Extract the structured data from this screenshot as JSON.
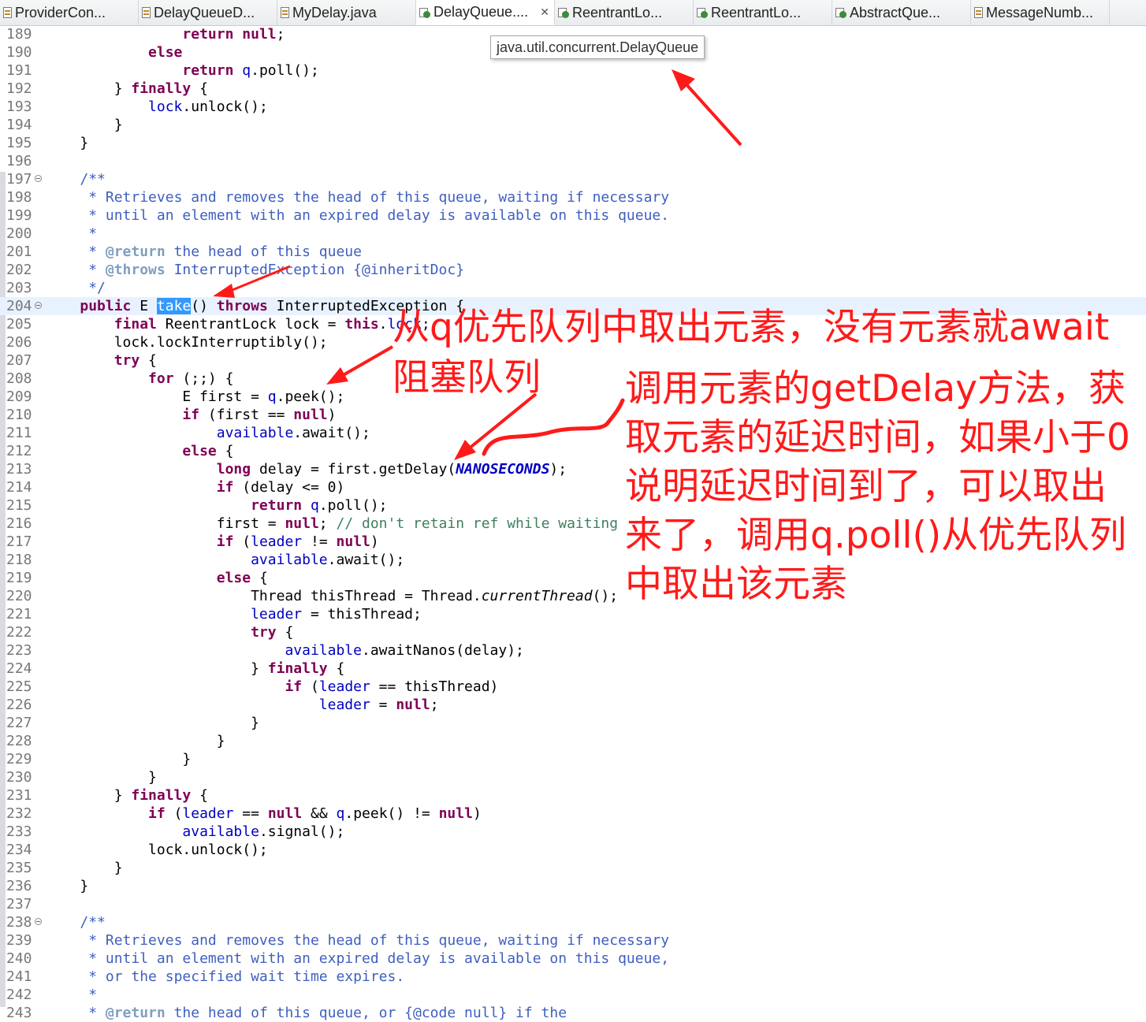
{
  "tabs": [
    {
      "label": "ProviderCon...",
      "icon": "java-file-icon"
    },
    {
      "label": "DelayQueueD...",
      "icon": "java-file-icon"
    },
    {
      "label": "MyDelay.java",
      "icon": "java-file-icon"
    },
    {
      "label": "DelayQueue....",
      "icon": "class-file-icon",
      "active": true,
      "close": "✕"
    },
    {
      "label": "ReentrantLo...",
      "icon": "class-file-icon"
    },
    {
      "label": "ReentrantLo...",
      "icon": "class-file-icon"
    },
    {
      "label": "AbstractQue...",
      "icon": "class-file-icon"
    },
    {
      "label": "MessageNumb...",
      "icon": "java-file-icon"
    }
  ],
  "tooltip": {
    "text": "java.util.concurrent.DelayQueue"
  },
  "code": {
    "line_numbers": [
      "189",
      "190",
      "191",
      "192",
      "193",
      "194",
      "195",
      "196",
      "197",
      "198",
      "199",
      "200",
      "201",
      "202",
      "203",
      "204",
      "205",
      "206",
      "207",
      "208",
      "209",
      "210",
      "211",
      "212",
      "213",
      "214",
      "215",
      "216",
      "217",
      "218",
      "219",
      "220",
      "221",
      "222",
      "223",
      "224",
      "225",
      "226",
      "227",
      "228",
      "229",
      "230",
      "231",
      "232",
      "233",
      "234",
      "235",
      "236",
      "237",
      "238",
      "239",
      "240",
      "241",
      "242",
      "243"
    ],
    "l189": {
      "t0": "                ",
      "kw": "return",
      "t1": " ",
      "kw2": "null",
      "t2": ";"
    },
    "l190": {
      "t0": "            ",
      "kw": "else"
    },
    "l191": {
      "t0": "                ",
      "kw": "return",
      "t1": " ",
      "fd": "q",
      "t2": ".poll();"
    },
    "l192": {
      "t0": "        } ",
      "kw": "finally",
      "t1": " {"
    },
    "l193": {
      "t0": "            ",
      "fd": "lock",
      "t1": ".unlock();"
    },
    "l194": {
      "t0": "        }"
    },
    "l195": {
      "t0": "    }"
    },
    "l196": {
      "t0": ""
    },
    "l197": {
      "t0": "    ",
      "jd": "/**"
    },
    "l198": {
      "t0": "    ",
      "jd": " * Retrieves and removes the head of this queue, waiting if necessary"
    },
    "l199": {
      "t0": "    ",
      "jd": " * until an element with an expired delay is available on this queue."
    },
    "l200": {
      "t0": "    ",
      "jd": " *"
    },
    "l201": {
      "t0": "    ",
      "jd": " * ",
      "tag": "@return",
      "jd2": " the head of this queue"
    },
    "l202": {
      "t0": "    ",
      "jd": " * ",
      "tag": "@throws",
      "jd2": " InterruptedException {@inheritDoc}"
    },
    "l203": {
      "t0": "    ",
      "jd": " */"
    },
    "l204": {
      "t0": "    ",
      "kw": "public",
      "t1": " E ",
      "sel": "take",
      "t2": "() ",
      "kw2": "throws",
      "t3": " InterruptedException {"
    },
    "l205": {
      "t0": "        ",
      "kw": "final",
      "t1": " ReentrantLock lock = ",
      "kw2": "this",
      "t2": ".",
      "fd": "lock",
      "t3": ";"
    },
    "l206": {
      "t0": "        lock.lockInterruptibly();"
    },
    "l207": {
      "t0": "        ",
      "kw": "try",
      "t1": " {"
    },
    "l208": {
      "t0": "            ",
      "kw": "for",
      "t1": " (;;) {"
    },
    "l209": {
      "t0": "                E first = ",
      "fd": "q",
      "t1": ".peek();"
    },
    "l210": {
      "t0": "                ",
      "kw": "if",
      "t1": " (first == ",
      "kw2": "null",
      "t2": ")"
    },
    "l211": {
      "t0": "                    ",
      "fd": "available",
      "t1": ".await();"
    },
    "l212": {
      "t0": "                ",
      "kw": "else",
      "t1": " {"
    },
    "l213": {
      "t0": "                    ",
      "kw": "long",
      "t1": " delay = first.getDelay(",
      "cst": "NANOSECONDS",
      "t2": ");"
    },
    "l214": {
      "t0": "                    ",
      "kw": "if",
      "t1": " (delay <= 0)"
    },
    "l215": {
      "t0": "                        ",
      "kw": "return",
      "t1": " ",
      "fd": "q",
      "t2": ".poll();"
    },
    "l216": {
      "t0": "                    first = ",
      "kw": "null",
      "t1": "; ",
      "cm": "// don't retain ref while waiting"
    },
    "l217": {
      "t0": "                    ",
      "kw": "if",
      "t1": " (",
      "fd": "leader",
      "t2": " != ",
      "kw2": "null",
      "t3": ")"
    },
    "l218": {
      "t0": "                        ",
      "fd": "available",
      "t1": ".await();"
    },
    "l219": {
      "t0": "                    ",
      "kw": "else",
      "t1": " {"
    },
    "l220": {
      "t0": "                        Thread thisThread = Thread.",
      "it": "currentThread",
      "t1": "();"
    },
    "l221": {
      "t0": "                        ",
      "fd": "leader",
      "t1": " = thisThread;"
    },
    "l222": {
      "t0": "                        ",
      "kw": "try",
      "t1": " {"
    },
    "l223": {
      "t0": "                            ",
      "fd": "available",
      "t1": ".awaitNanos(delay);"
    },
    "l224": {
      "t0": "                        } ",
      "kw": "finally",
      "t1": " {"
    },
    "l225": {
      "t0": "                            ",
      "kw": "if",
      "t1": " (",
      "fd": "leader",
      "t2": " == thisThread)"
    },
    "l226": {
      "t0": "                                ",
      "fd": "leader",
      "t1": " = ",
      "kw": "null",
      "t2": ";"
    },
    "l227": {
      "t0": "                        }"
    },
    "l228": {
      "t0": "                    }"
    },
    "l229": {
      "t0": "                }"
    },
    "l230": {
      "t0": "            }"
    },
    "l231": {
      "t0": "        } ",
      "kw": "finally",
      "t1": " {"
    },
    "l232": {
      "t0": "            ",
      "kw": "if",
      "t1": " (",
      "fd": "leader",
      "t2": " == ",
      "kw2": "null",
      "t3": " && ",
      "fd2": "q",
      "t4": ".peek() != ",
      "kw3": "null",
      "t5": ")"
    },
    "l233": {
      "t0": "                ",
      "fd": "available",
      "t1": ".signal();"
    },
    "l234": {
      "t0": "            lock.unlock();"
    },
    "l235": {
      "t0": "        }"
    },
    "l236": {
      "t0": "    }"
    },
    "l237": {
      "t0": ""
    },
    "l238": {
      "t0": "    ",
      "jd": "/**"
    },
    "l239": {
      "t0": "    ",
      "jd": " * Retrieves and removes the head of this queue, waiting if necessary"
    },
    "l240": {
      "t0": "    ",
      "jd": " * until an element with an expired delay is available on this queue,"
    },
    "l241": {
      "t0": "    ",
      "jd": " * or the specified wait time expires."
    },
    "l242": {
      "t0": "    ",
      "jd": " *"
    },
    "l243": {
      "t0": "    ",
      "jd": " * ",
      "tag": "@return",
      "jd2": " the head of this queue, or {@code null} if the"
    }
  },
  "annotations": {
    "note1_line1": "从q优先队列中取出元素，没有元素就await",
    "note1_line2": "阻塞队列",
    "note2_line1": "调用元素的getDelay方法，获",
    "note2_line2": "取元素的延迟时间，如果小于0",
    "note2_line3": "说明延迟时间到了，可以取出",
    "note2_line4": "来了，调用q.poll()从优先队列",
    "note2_line5": "中取出该元素",
    "color": "#ff1a1a"
  },
  "colors": {
    "keyword": "#7f0055",
    "javadoc": "#3f5fbf",
    "comment": "#3f7f5f",
    "field": "#0000c0",
    "selection": "#3399ff",
    "current_line": "#e8f2fe"
  }
}
